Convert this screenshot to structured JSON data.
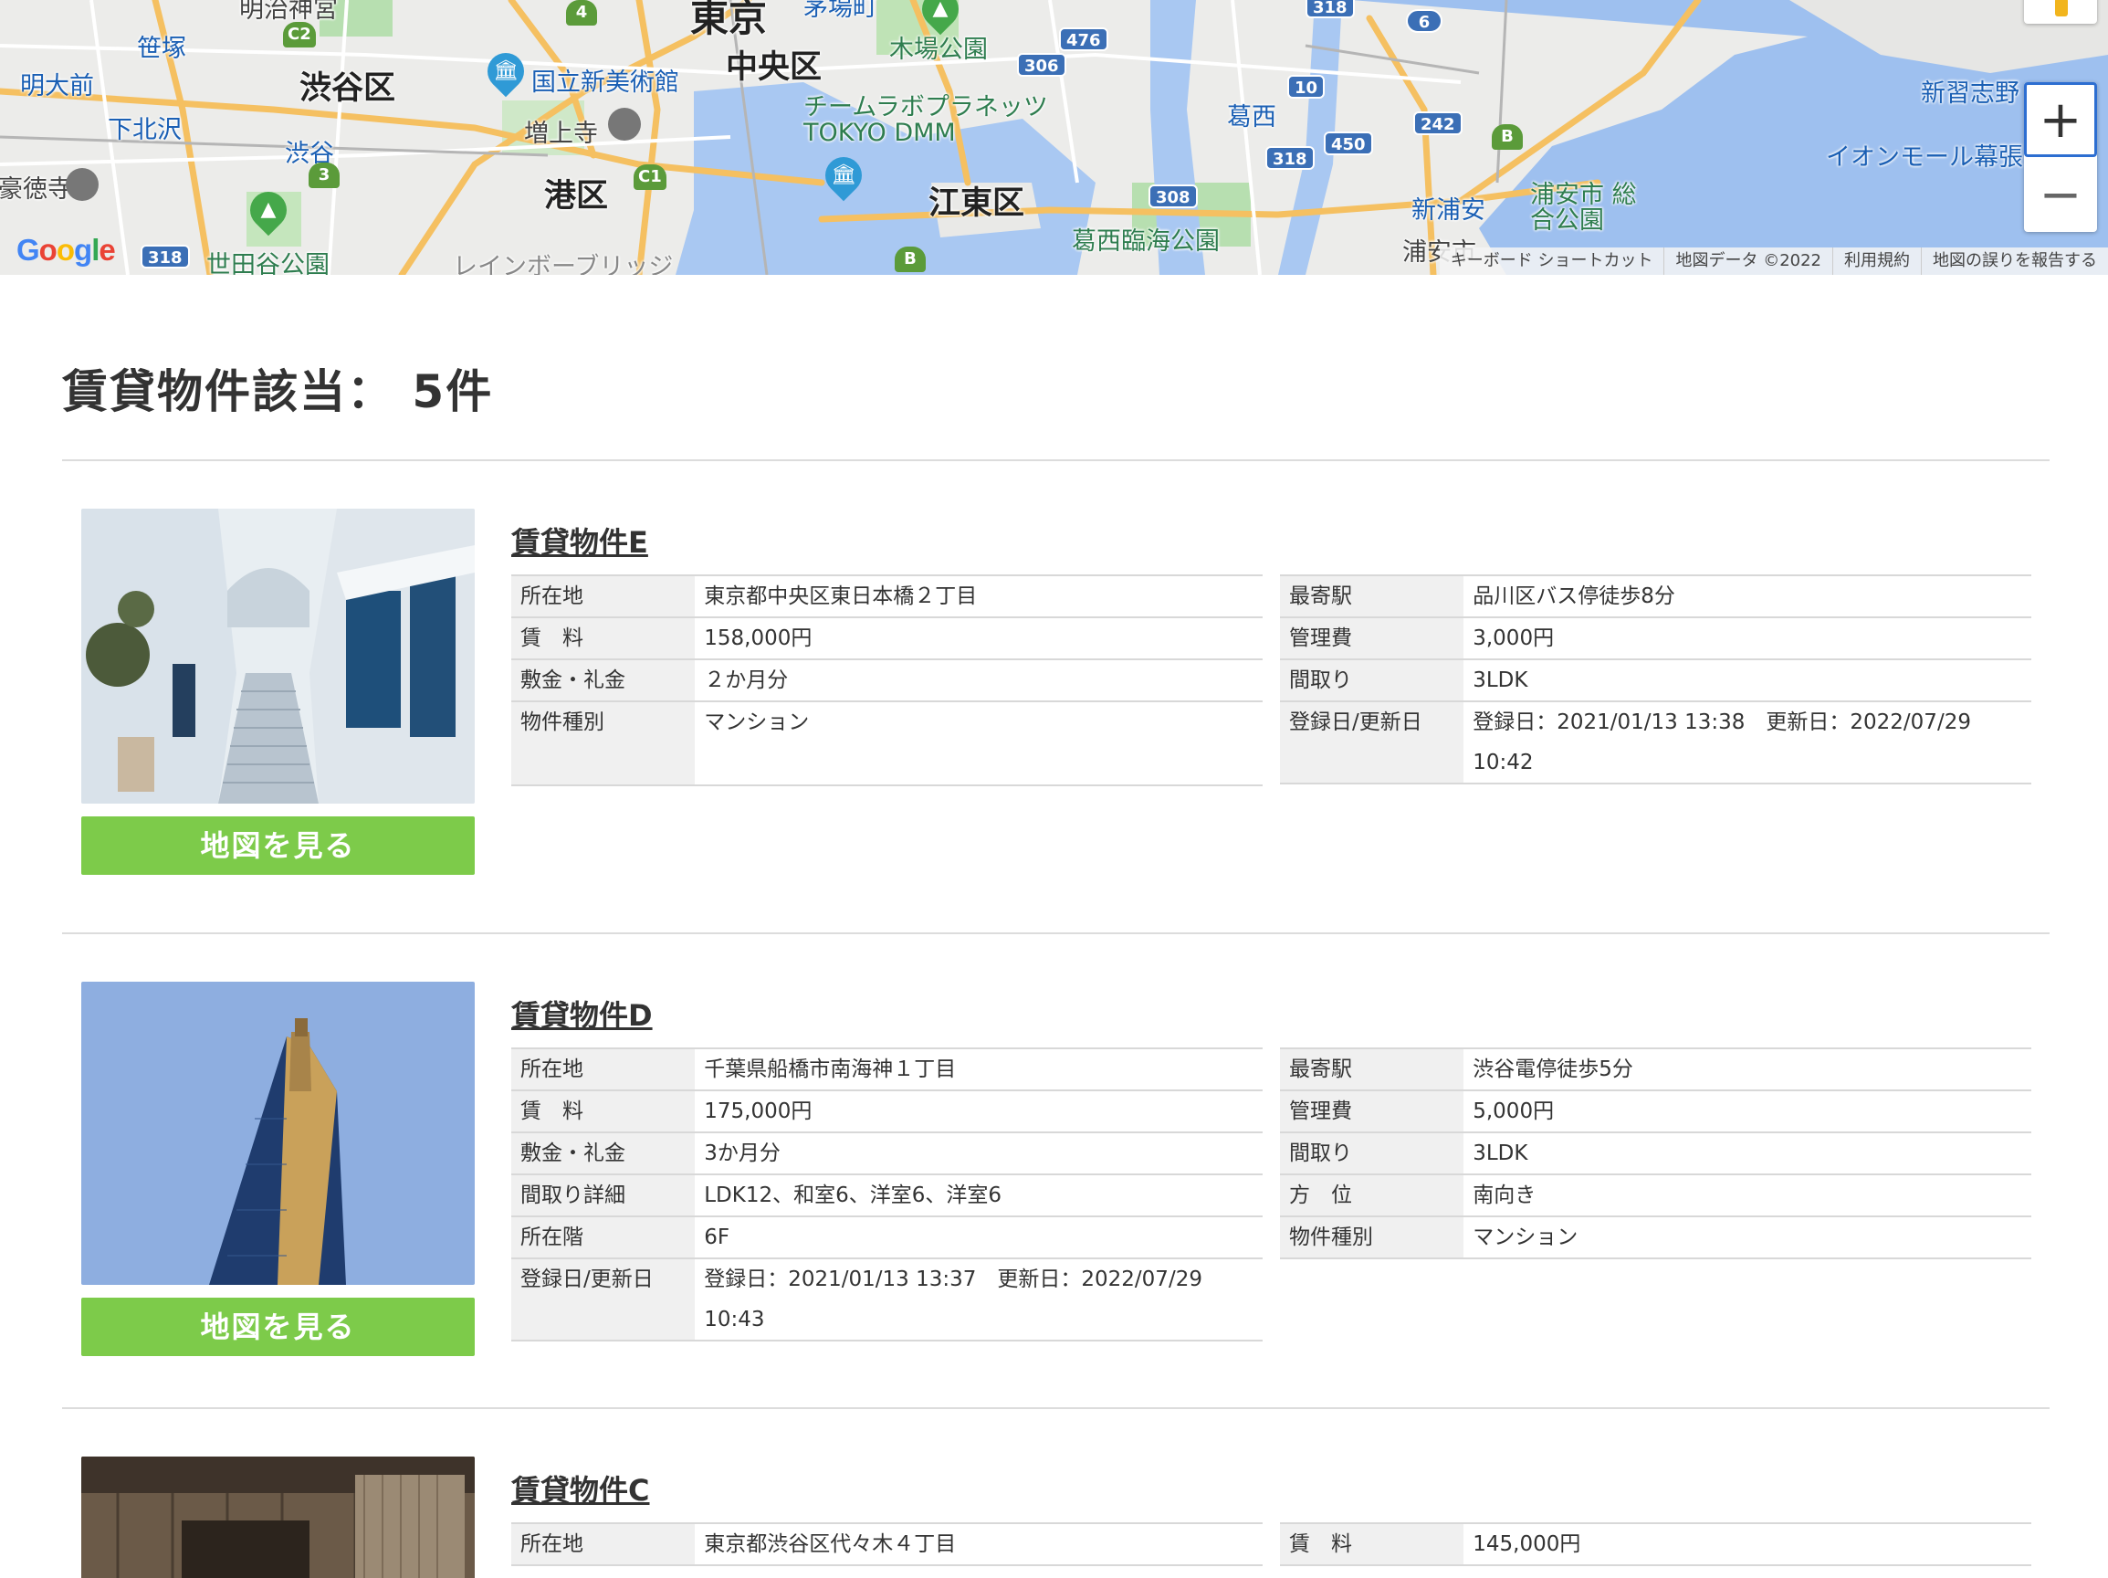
{
  "map": {
    "labels": {
      "wards": [
        "渋谷区",
        "中央区",
        "港区",
        "江東区",
        "東京"
      ],
      "places": [
        "明治神宮",
        "笹塚",
        "明大前",
        "下北沢",
        "豪徳寺",
        "世田谷公園",
        "渋谷",
        "増上寺",
        "国立新美術館",
        "レインボーブリッジ",
        "木場公園",
        "チームラボプラネッツ TOKYO DMM",
        "葛西臨海公園",
        "葛西",
        "新浦安",
        "浦安市 総合公園",
        "浦安市",
        "新習志野",
        "イオンモール幕張",
        "茅場町"
      ],
      "routes": [
        "C2",
        "3",
        "C1",
        "4",
        "318",
        "306",
        "476",
        "10",
        "450",
        "318",
        "308",
        "242",
        "6",
        "B",
        "B",
        "318",
        "318"
      ]
    },
    "google_logo": "Google",
    "footer": {
      "shortcuts": "キーボード ショートカット",
      "map_data": "地図データ ©2022",
      "terms": "利用規約",
      "report": "地図の誤りを報告する"
    },
    "zoom_in": "+",
    "zoom_out": "−"
  },
  "results": {
    "heading": "賃貸物件該当： 5件"
  },
  "listings": [
    {
      "title": "賃貸物件E",
      "map_button": "地図を見る",
      "image": "whitewashed-alley-photo",
      "left": [
        {
          "key": "所在地",
          "value": "東京都中央区東日本橋２丁目"
        },
        {
          "key": "賃　料",
          "value": "158,000円"
        },
        {
          "key": "敷金・礼金",
          "value": "２か月分"
        },
        {
          "key": "物件種別",
          "value": "マンション"
        }
      ],
      "right": [
        {
          "key": "最寄駅",
          "value": "品川区バス停徒歩8分"
        },
        {
          "key": "管理費",
          "value": "3,000円"
        },
        {
          "key": "間取り",
          "value": "3LDK"
        },
        {
          "key": "登録日/更新日",
          "value": "登録日：2021/01/13 13:38　更新日：2022/07/29 10:42"
        }
      ]
    },
    {
      "title": "賃貸物件D",
      "map_button": "地図を見る",
      "image": "glass-tower-photo",
      "left": [
        {
          "key": "所在地",
          "value": "千葉県船橋市南海神１丁目"
        },
        {
          "key": "賃　料",
          "value": "175,000円"
        },
        {
          "key": "敷金・礼金",
          "value": "3か月分"
        },
        {
          "key": "間取り詳細",
          "value": "LDK12、和室6、洋室6、洋室6"
        },
        {
          "key": "所在階",
          "value": "6F"
        },
        {
          "key": "登録日/更新日",
          "value": "登録日：2021/01/13 13:37　更新日：2022/07/29 10:43"
        }
      ],
      "right": [
        {
          "key": "最寄駅",
          "value": "渋谷電停徒歩5分"
        },
        {
          "key": "管理費",
          "value": "5,000円"
        },
        {
          "key": "間取り",
          "value": "3LDK"
        },
        {
          "key": "方　位",
          "value": "南向き"
        },
        {
          "key": "物件種別",
          "value": "マンション"
        }
      ]
    },
    {
      "title": "賃貸物件C",
      "map_button": "地図を見る",
      "image": "wooden-house-photo",
      "left": [
        {
          "key": "所在地",
          "value": "東京都渋谷区代々木４丁目"
        }
      ],
      "right": [
        {
          "key": "賃　料",
          "value": "145,000円"
        }
      ]
    }
  ]
}
